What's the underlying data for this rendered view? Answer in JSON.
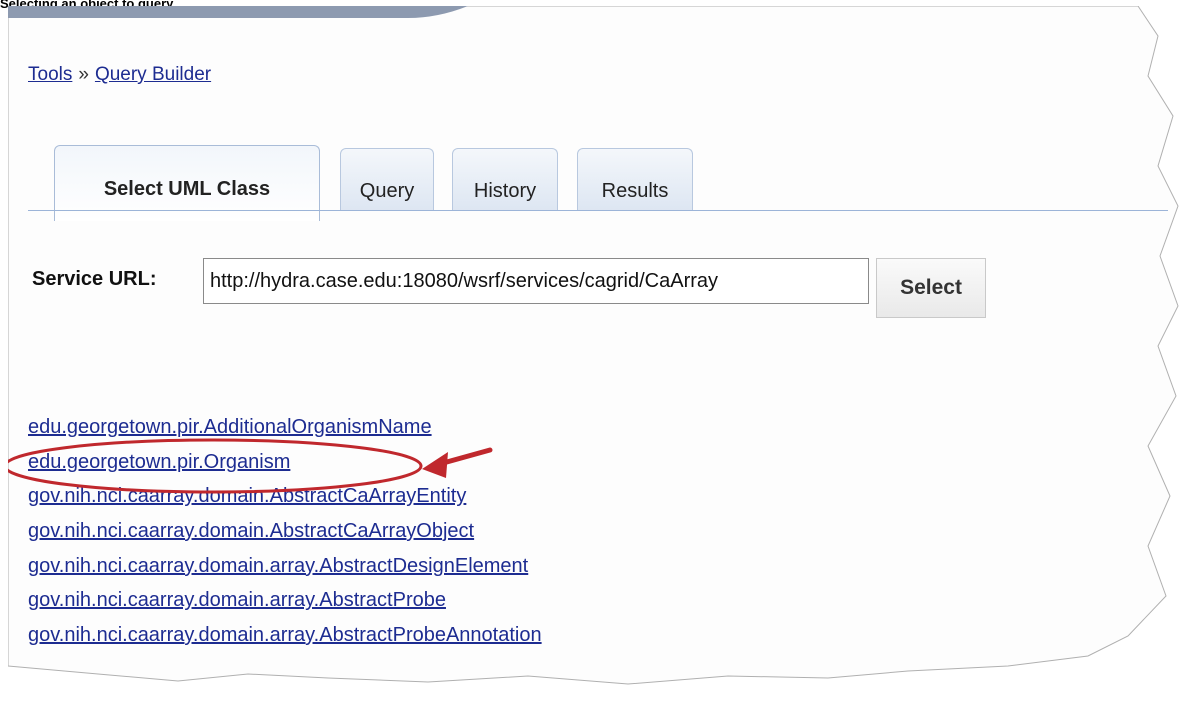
{
  "caption": "Selecting an object to query",
  "breadcrumb": {
    "tools": "Tools",
    "separator": "»",
    "current": "Query Builder"
  },
  "tabs": [
    {
      "label": "Select UML Class",
      "active": true
    },
    {
      "label": "Query",
      "active": false
    },
    {
      "label": "History",
      "active": false
    },
    {
      "label": "Results",
      "active": false
    }
  ],
  "service": {
    "label": "Service URL:",
    "value": "http://hydra.case.edu:18080/wsrf/services/cagrid/CaArray",
    "button_label": "Select"
  },
  "classes": [
    "edu.georgetown.pir.AdditionalOrganismName",
    "edu.georgetown.pir.Organism",
    "gov.nih.nci.caarray.domain.AbstractCaArrayEntity",
    "gov.nih.nci.caarray.domain.AbstractCaArrayObject",
    "gov.nih.nci.caarray.domain.array.AbstractDesignElement",
    "gov.nih.nci.caarray.domain.array.AbstractProbe",
    "gov.nih.nci.caarray.domain.array.AbstractProbeAnnotation"
  ],
  "highlight": {
    "color": "#c0282d",
    "target": "edu.georgetown.pir.Organism"
  }
}
